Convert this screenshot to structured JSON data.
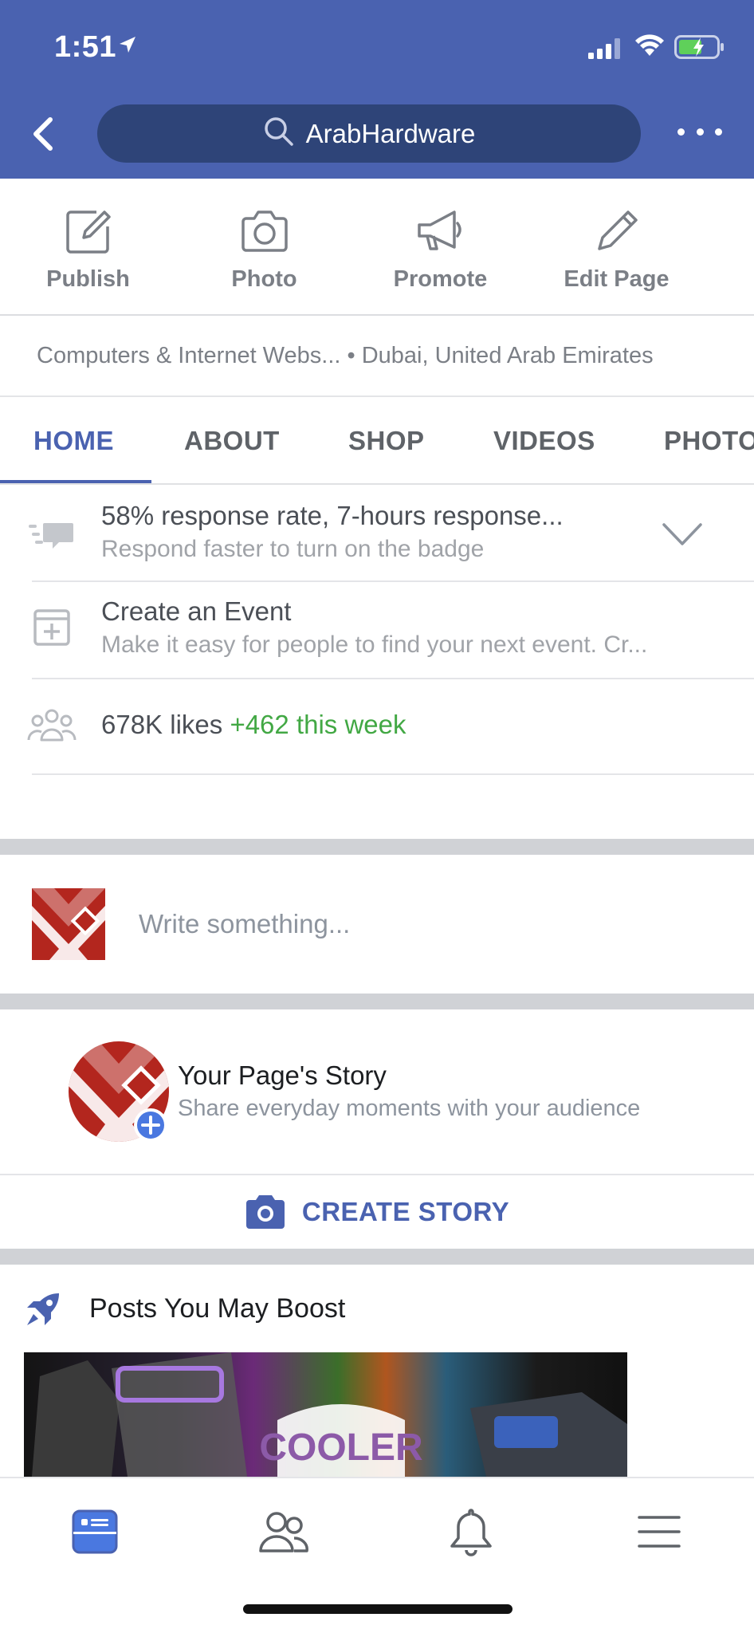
{
  "status_bar": {
    "time": "1:51"
  },
  "header": {
    "search_text": "ArabHardware"
  },
  "actions": [
    {
      "label": "Publish",
      "icon": "edit-square-icon"
    },
    {
      "label": "Photo",
      "icon": "camera-icon"
    },
    {
      "label": "Promote",
      "icon": "megaphone-icon"
    },
    {
      "label": "Edit Page",
      "icon": "pencil-icon"
    }
  ],
  "category": {
    "text": "Computers & Internet Webs... • Dubai, United Arab Emirates"
  },
  "tabs": [
    "HOME",
    "ABOUT",
    "SHOP",
    "VIDEOS",
    "PHOTOS"
  ],
  "active_tab": "HOME",
  "info_rows": {
    "response": {
      "title": "58% response rate, 7-hours response...",
      "subtitle": "Respond faster to turn on the badge"
    },
    "event": {
      "title": "Create an Event",
      "subtitle": "Make it easy for people to find your next event. Cr..."
    },
    "likes": {
      "count": "678K likes",
      "delta": "+462 this week"
    }
  },
  "composer": {
    "placeholder": "Write something..."
  },
  "story": {
    "title": "Your Page's Story",
    "subtitle": "Share everyday moments with your audience",
    "button": "CREATE STORY"
  },
  "boost": {
    "title": "Posts You May Boost",
    "image_text": "COOLER"
  },
  "colors": {
    "brand": "#4a62b0",
    "positive": "#42a844",
    "logo_red": "#b3261e"
  },
  "bottom_nav": [
    "home-feed-icon",
    "friends-icon",
    "notifications-bell-icon",
    "menu-icon"
  ]
}
